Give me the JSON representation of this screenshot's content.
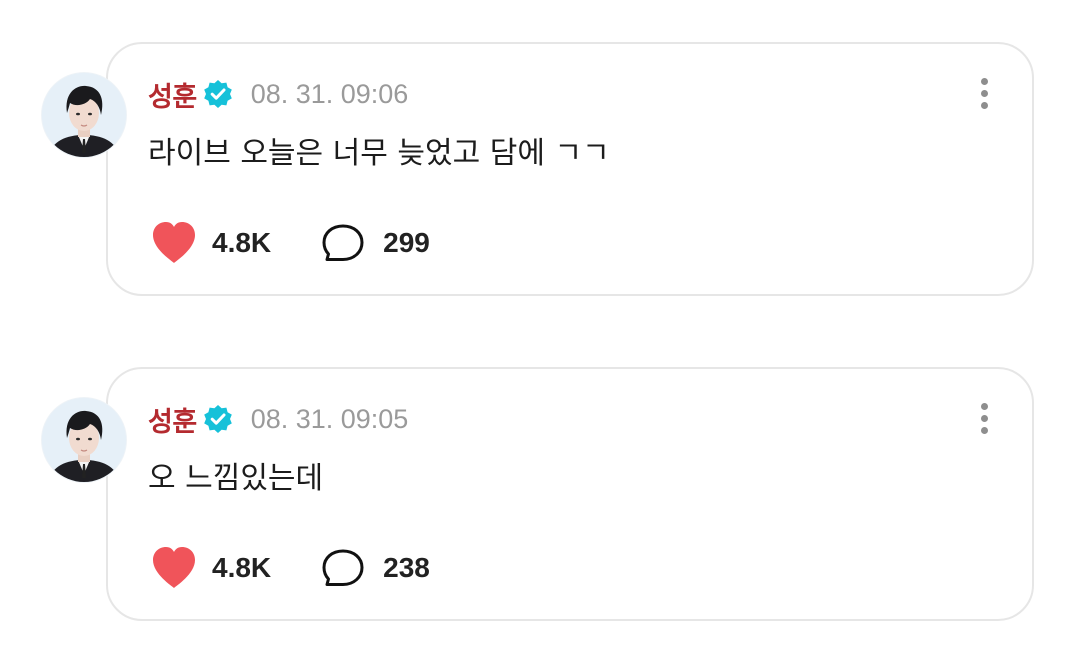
{
  "colors": {
    "author": "#b42a2f",
    "verified_badge": "#16c1d9",
    "heart": "#f0545a",
    "timestamp": "#9a9a9a",
    "card_border": "#e6e6e6"
  },
  "posts": [
    {
      "author": "성훈",
      "verified": true,
      "timestamp": "08. 31. 09:06",
      "text": "라이브 오늘은 너무 늦었고 담에 ㄱㄱ",
      "likes": "4.8K",
      "replies": "299",
      "icons": {
        "like": "heart-icon",
        "reply": "speech-bubble-icon",
        "more": "more-vertical-icon"
      }
    },
    {
      "author": "성훈",
      "verified": true,
      "timestamp": "08. 31. 09:05",
      "text": "오 느낌있는데",
      "likes": "4.8K",
      "replies": "238",
      "icons": {
        "like": "heart-icon",
        "reply": "speech-bubble-icon",
        "more": "more-vertical-icon"
      }
    }
  ]
}
